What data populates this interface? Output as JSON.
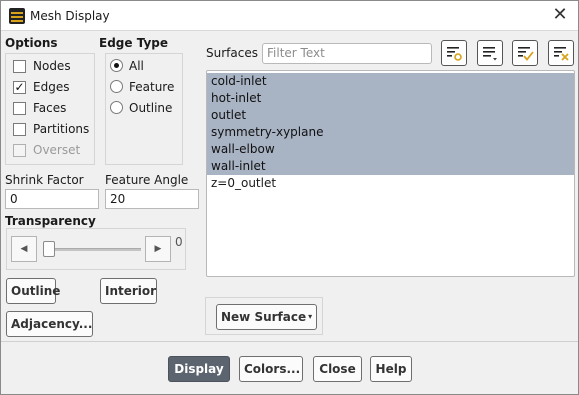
{
  "window": {
    "title": "Mesh Display"
  },
  "options": {
    "heading": "Options",
    "items": [
      {
        "label": "Nodes",
        "checked": false,
        "disabled": false
      },
      {
        "label": "Edges",
        "checked": true,
        "disabled": false
      },
      {
        "label": "Faces",
        "checked": false,
        "disabled": false
      },
      {
        "label": "Partitions",
        "checked": false,
        "disabled": false
      },
      {
        "label": "Overset",
        "checked": false,
        "disabled": true
      }
    ]
  },
  "edge_type": {
    "heading": "Edge Type",
    "items": [
      {
        "label": "All",
        "selected": true
      },
      {
        "label": "Feature",
        "selected": false
      },
      {
        "label": "Outline",
        "selected": false
      }
    ]
  },
  "shrink_factor": {
    "label": "Shrink Factor",
    "value": "0"
  },
  "feature_angle": {
    "label": "Feature Angle",
    "value": "20"
  },
  "transparency": {
    "label": "Transparency",
    "value": "0",
    "level": 0
  },
  "left_buttons": {
    "outline": "Outline",
    "interior": "Interior",
    "adjacency": "Adjacency..."
  },
  "surfaces": {
    "label": "Surfaces",
    "filter_placeholder": "Filter Text",
    "items": [
      {
        "name": "cold-inlet",
        "selected": true
      },
      {
        "name": "hot-inlet",
        "selected": true
      },
      {
        "name": "outlet",
        "selected": true
      },
      {
        "name": "symmetry-xyplane",
        "selected": true
      },
      {
        "name": "wall-elbow",
        "selected": true
      },
      {
        "name": "wall-inlet",
        "selected": true
      },
      {
        "name": "z=0_outlet",
        "selected": false
      }
    ]
  },
  "new_surface": {
    "label": "New Surface"
  },
  "footer": {
    "display": "Display",
    "colors": "Colors...",
    "close": "Close",
    "help": "Help"
  },
  "colors": {
    "selection": "#a8b3c4",
    "primary_button": "#5c6470"
  }
}
